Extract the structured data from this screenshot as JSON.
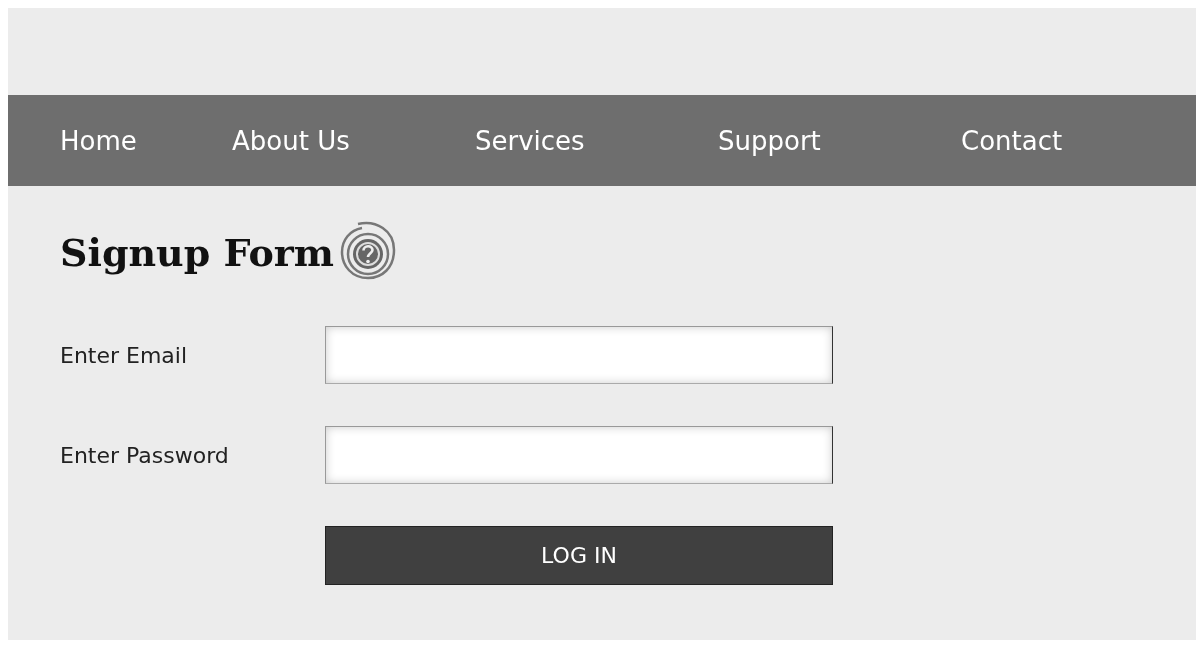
{
  "nav": {
    "items": [
      {
        "label": "Home"
      },
      {
        "label": "About Us"
      },
      {
        "label": "Services"
      },
      {
        "label": "Support"
      },
      {
        "label": "Contact"
      }
    ]
  },
  "form": {
    "title": "Signup Form",
    "fields": [
      {
        "label": "Enter Email"
      },
      {
        "label": "Enter Password"
      }
    ],
    "submit": "LOG IN"
  }
}
